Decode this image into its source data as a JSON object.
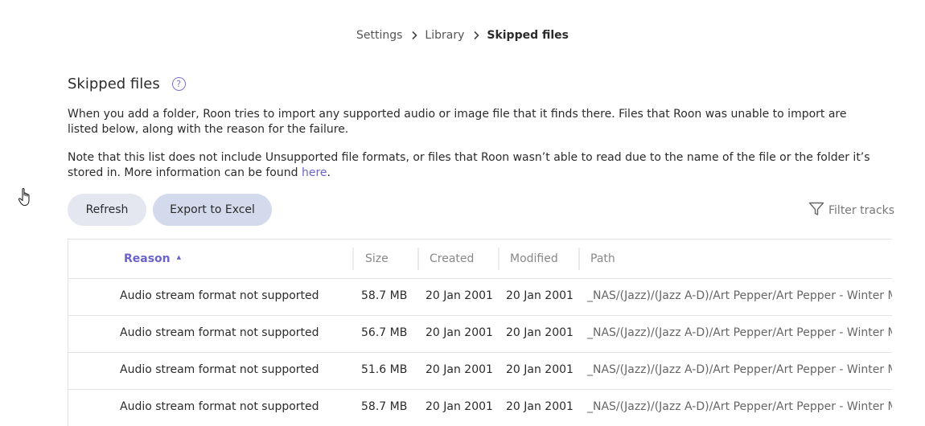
{
  "breadcrumb": {
    "items": [
      "Settings",
      "Library",
      "Skipped files"
    ]
  },
  "heading": {
    "title": "Skipped files",
    "help_glyph": "?"
  },
  "description": {
    "para1": "When you add a folder, Roon tries to import any supported audio or image file that it finds there. Files that Roon was unable to import are listed below, along with the reason for the failure.",
    "para2_prefix": "Note that this list does not include Unsupported file formats, or files that Roon wasn’t able to read due to the name of the file or the folder it’s stored in. More information can be found ",
    "para2_link": "here",
    "para2_suffix": "."
  },
  "toolbar": {
    "refresh_label": "Refresh",
    "export_label": "Export to Excel",
    "filter_label": "Filter tracks"
  },
  "table": {
    "columns": {
      "reason": "Reason",
      "size": "Size",
      "created": "Created",
      "modified": "Modified",
      "path": "Path"
    },
    "sort": {
      "column": "reason",
      "direction": "ascending"
    },
    "rows": [
      {
        "reason": "Audio stream format not supported",
        "size": "58.7 MB",
        "created": "20 Jan 2001",
        "modified": "20 Jan 2001",
        "path": "_NAS/(Jazz)/(Jazz A-D)/Art Pepper/Art Pepper - Winter M"
      },
      {
        "reason": "Audio stream format not supported",
        "size": "56.7 MB",
        "created": "20 Jan 2001",
        "modified": "20 Jan 2001",
        "path": "_NAS/(Jazz)/(Jazz A-D)/Art Pepper/Art Pepper - Winter M"
      },
      {
        "reason": "Audio stream format not supported",
        "size": "51.6 MB",
        "created": "20 Jan 2001",
        "modified": "20 Jan 2001",
        "path": "_NAS/(Jazz)/(Jazz A-D)/Art Pepper/Art Pepper - Winter M"
      },
      {
        "reason": "Audio stream format not supported",
        "size": "58.7 MB",
        "created": "20 Jan 2001",
        "modified": "20 Jan 2001",
        "path": "_NAS/(Jazz)/(Jazz A-D)/Art Pepper/Art Pepper - Winter M"
      }
    ]
  },
  "colors": {
    "accent": "#6b63c9",
    "button_refresh_bg": "#e4e7f0",
    "button_export_bg": "#d3daeb"
  },
  "icons": {
    "breadcrumb_separator": "chevron-right-icon",
    "help": "question-circle-icon",
    "filter": "funnel-icon",
    "sort": "sort-ascending-icon",
    "cursor": "hand-pointer-icon"
  }
}
